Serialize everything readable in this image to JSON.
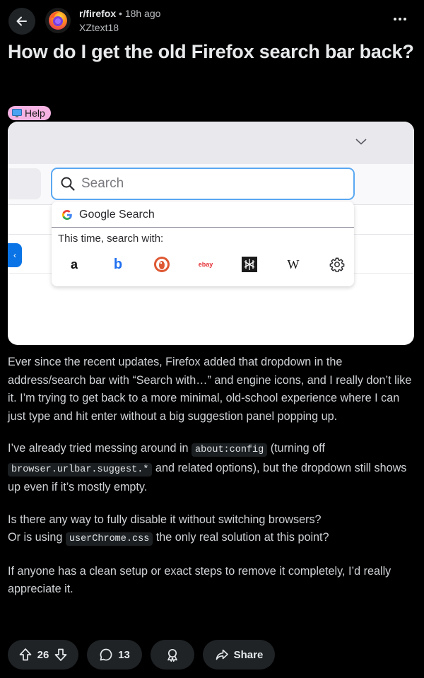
{
  "header": {
    "subreddit": "r/firefox",
    "separator": "•",
    "time_ago": "18h ago",
    "author": "XZtext18"
  },
  "post": {
    "title": "How do I get the old Firefox search bar back?",
    "flair": "Help"
  },
  "screenshot": {
    "search_placeholder": "Search",
    "suggestion_label": "Google Search",
    "search_with_label": "This time, search with:",
    "engines": [
      "amazon-icon",
      "bing-icon",
      "duckduckgo-icon",
      "ebay-icon",
      "perplexity-icon",
      "wikipedia-icon",
      "settings-gear-icon"
    ],
    "ebay_text": "ebay",
    "wiki_text": "W",
    "amazon_text": "a",
    "bing_text": "b"
  },
  "body": {
    "p1": "Ever since the recent updates, Firefox added that dropdown in the address/search bar with “Search with…” and engine icons, and I really don’t like it. I’m trying to get back to a more minimal, old-school experience where I can just type and hit enter without a big suggestion panel popping up.",
    "p2_a": "I’ve already tried messing around in ",
    "p2_code1": "about:config",
    "p2_b": " (turning off ",
    "p2_code2": "browser.urlbar.suggest.*",
    "p2_c": " and related options), but the dropdown still shows up even if it’s mostly empty.",
    "p3_a": "Is there any way to fully disable it without switching browsers?",
    "p3_b": "Or is using ",
    "p3_code": "userChrome.css",
    "p3_c": " the only real solution at this point?",
    "p4": "If anyone has a clean setup or exact steps to remove it completely, I’d really appreciate it."
  },
  "actions": {
    "votes": "26",
    "comments": "13",
    "share": "Share"
  }
}
